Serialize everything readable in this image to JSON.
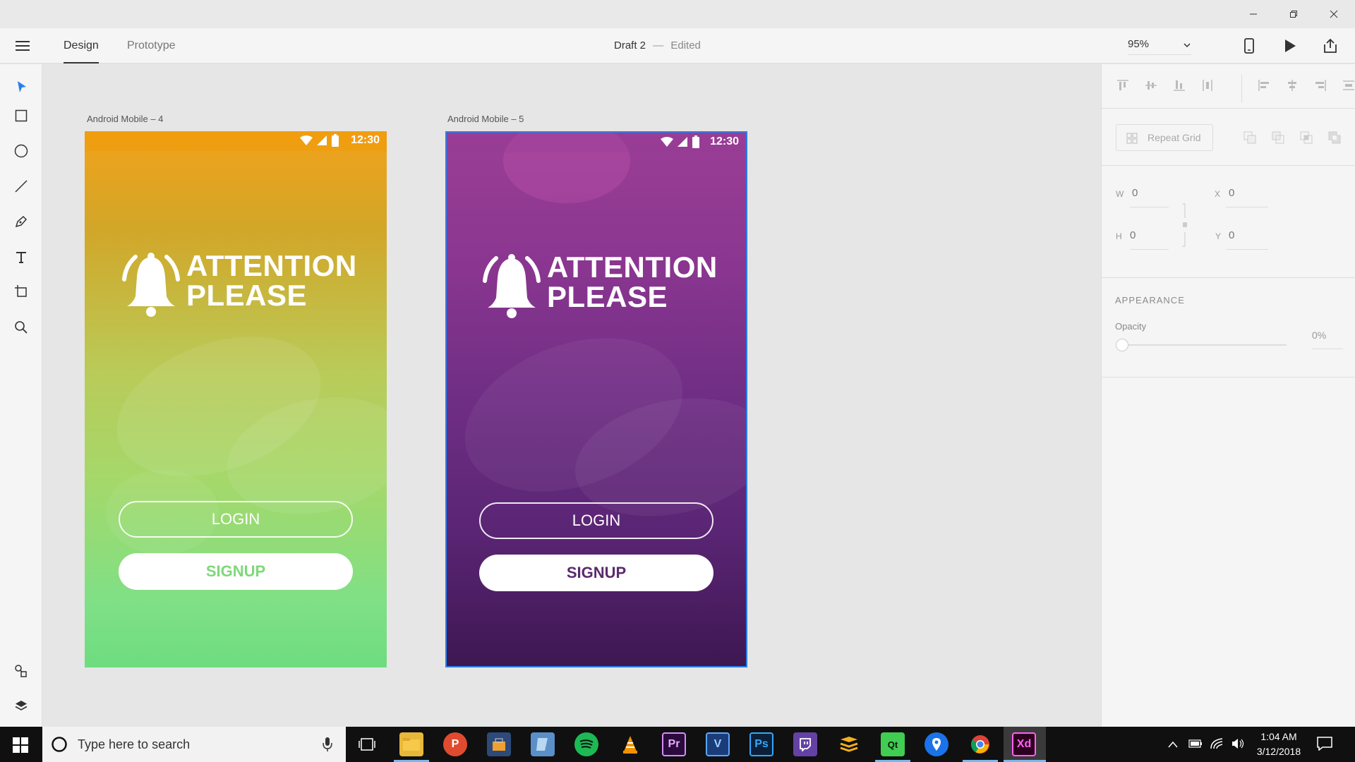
{
  "window": {
    "minimize_icon": "minimize-icon",
    "restore_icon": "restore-icon",
    "close_icon": "close-icon"
  },
  "header": {
    "tabs": [
      {
        "label": "Design",
        "active": true
      },
      {
        "label": "Prototype",
        "active": false
      }
    ],
    "doc_title": "Draft 2",
    "doc_separator": "—",
    "doc_status": "Edited",
    "zoom": "95%"
  },
  "toolbar": {
    "tools": [
      "select-icon",
      "rectangle-icon",
      "ellipse-icon",
      "line-icon",
      "pen-icon",
      "text-icon",
      "artboard-icon",
      "zoom-icon"
    ],
    "bottom": [
      "symbols-icon",
      "layers-icon"
    ]
  },
  "artboards": [
    {
      "label": "Android Mobile – 4",
      "time": "12:30",
      "logo_line1": "ATTENTION",
      "logo_line2": "PLEASE",
      "login": "LOGIN",
      "signup": "SIGNUP",
      "signup_color": "#7fd87a"
    },
    {
      "label": "Android Mobile – 5",
      "time": "12:30",
      "logo_line1": "ATTENTION",
      "logo_line2": "PLEASE",
      "login": "LOGIN",
      "signup": "SIGNUP",
      "signup_color": "#5b2a6e"
    }
  ],
  "right_panel": {
    "repeat_grid": "Repeat Grid",
    "w_label": "W",
    "w_value": "0",
    "h_label": "H",
    "h_value": "0",
    "x_label": "X",
    "x_value": "0",
    "y_label": "Y",
    "y_value": "0",
    "appearance": "APPEARANCE",
    "opacity_label": "Opacity",
    "opacity_value": "0%"
  },
  "taskbar": {
    "search_placeholder": "Type here to search",
    "apps": [
      "file-explorer",
      "pocketcasts",
      "store",
      "notes",
      "spotify",
      "vlc",
      "premiere",
      "visio",
      "photoshop",
      "twitch",
      "stack",
      "qt",
      "maps",
      "chrome",
      "xd"
    ],
    "time": "1:04 AM",
    "date": "3/12/2018"
  },
  "colors": {
    "accent": "#2680eb",
    "orange_top": "#f2a21b",
    "green_bottom": "#6edc80",
    "purple_top": "#9b3e96",
    "purple_bottom": "#3e1752"
  }
}
